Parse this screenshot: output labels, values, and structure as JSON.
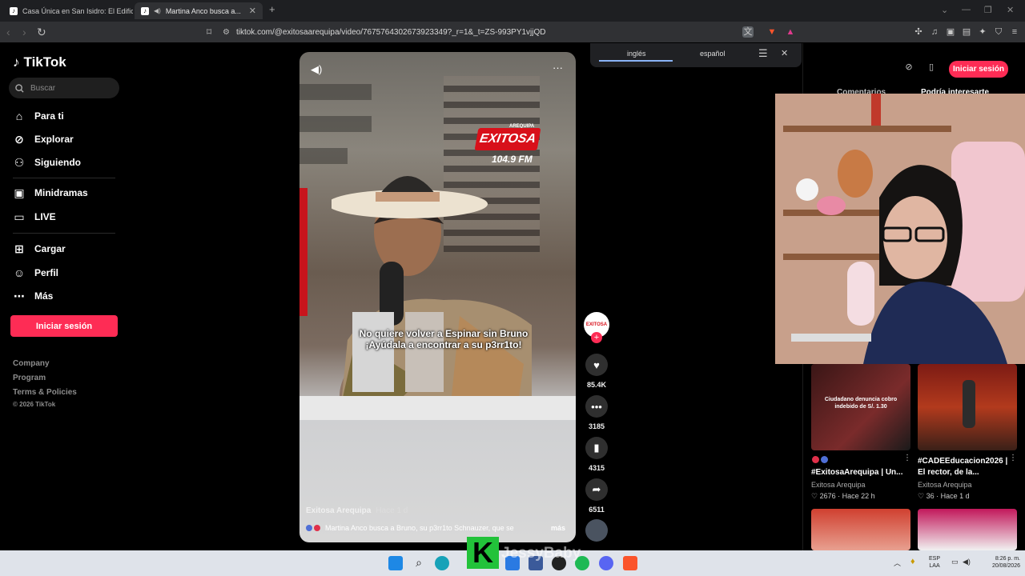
{
  "browser": {
    "tabs": [
      {
        "title": "Casa Única en San Isidro: El Edificio ...",
        "active": false
      },
      {
        "title": "Martina Anco busca a...",
        "active": true
      }
    ],
    "url": "tiktok.com/@exitosaarequipa/video/7675764302673923349?_r=1&_t=ZS-993PY1vjjQD"
  },
  "translate": {
    "options": [
      "inglés",
      "español"
    ],
    "selected": "inglés"
  },
  "sidebar": {
    "logo": "TikTok",
    "search_placeholder": "Buscar",
    "nav": [
      {
        "label": "Para ti",
        "icon": "home-icon"
      },
      {
        "label": "Explorar",
        "icon": "compass-icon"
      },
      {
        "label": "Siguiendo",
        "icon": "following-icon"
      },
      {
        "label": "Minidramas",
        "icon": "minidramas-icon"
      },
      {
        "label": "LIVE",
        "icon": "live-icon"
      },
      {
        "label": "Cargar",
        "icon": "upload-icon"
      },
      {
        "label": "Perfil",
        "icon": "profile-icon"
      },
      {
        "label": "Más",
        "icon": "more-icon"
      }
    ],
    "login": "Iniciar sesión",
    "footer": [
      "Company",
      "Program",
      "Terms & Policies"
    ],
    "copyright": "© 2026 TikTok"
  },
  "video": {
    "station": {
      "city": "AREQUIPA",
      "name": "EXITOSA",
      "freq": "104.9 FM"
    },
    "caption_line1": "No quiere volver a Espinar sin Bruno",
    "caption_line2": "¡Ayúdala a encontrar a su p3rr1to!",
    "author": "Exitosa Arequipa",
    "time": "Hace 1 d",
    "description": "Martina Anco busca a Bruno, su p3rr1to Schnauzer, que se",
    "more": "más"
  },
  "actions": {
    "likes": "85.4K",
    "comments": "3185",
    "saves": "4315",
    "shares": "6511",
    "avatar_label": "EXITOSA"
  },
  "right_panel": {
    "login": "Iniciar sesión",
    "tabs": [
      "Comentarios",
      "Podría interesarte"
    ],
    "videos": [
      {
        "thumb_text": "Ciudadano denuncia cobro indebido de S/. 1.30",
        "title": "#ExitosaArequipa | Un...",
        "author": "Exitosa Arequipa",
        "likes": "2676",
        "time": "Hace 22 h"
      },
      {
        "thumb_text": "",
        "title": "#CADEEducacion2026 | El rector, de la...",
        "author": "Exitosa Arequipa",
        "likes": "36",
        "time": "Hace 1 d"
      }
    ]
  },
  "stream_overlay": {
    "letter": "K",
    "name": "JessyBaby"
  },
  "taskbar": {
    "lang": "ESP",
    "region": "LAA",
    "time": "8:26 p. m.",
    "date": "20/08/2026"
  }
}
